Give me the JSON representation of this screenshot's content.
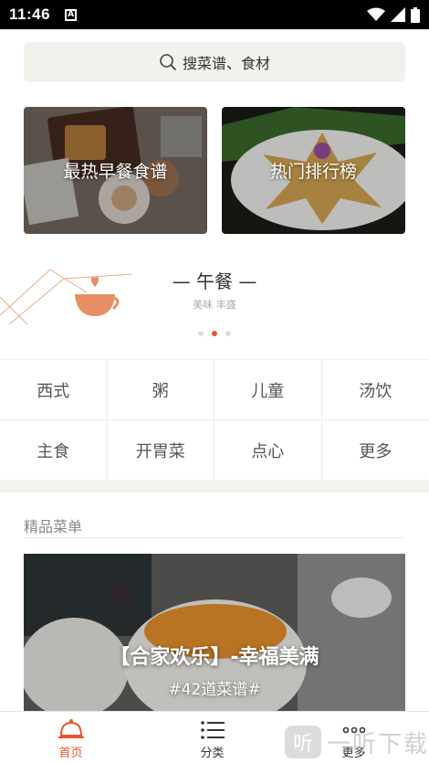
{
  "status": {
    "time": "11:46"
  },
  "search": {
    "placeholder": "搜菜谱、食材"
  },
  "cards": [
    {
      "title": "最热早餐食谱"
    },
    {
      "title": "热门排行榜"
    }
  ],
  "banner": {
    "meal": "— 午餐 —",
    "subtitle": "美味 丰盛",
    "page_count": 3,
    "active_page": 2
  },
  "categories": [
    "西式",
    "粥",
    "儿童",
    "汤饮",
    "主食",
    "开胃菜",
    "点心",
    "更多"
  ],
  "section": {
    "title": "精品菜单"
  },
  "featured": {
    "title": "【合家欢乐】-幸福美满",
    "subtitle": "#42道菜谱#"
  },
  "tabs": [
    {
      "label": "首页",
      "icon": "home-icon",
      "active": true
    },
    {
      "label": "分类",
      "icon": "list-icon",
      "active": false
    },
    {
      "label": "更多",
      "icon": "more-icon",
      "active": false
    }
  ],
  "watermark": {
    "text": "听 一听下载"
  },
  "colors": {
    "accent": "#e8572a",
    "search_bg": "#f2f1ec"
  }
}
